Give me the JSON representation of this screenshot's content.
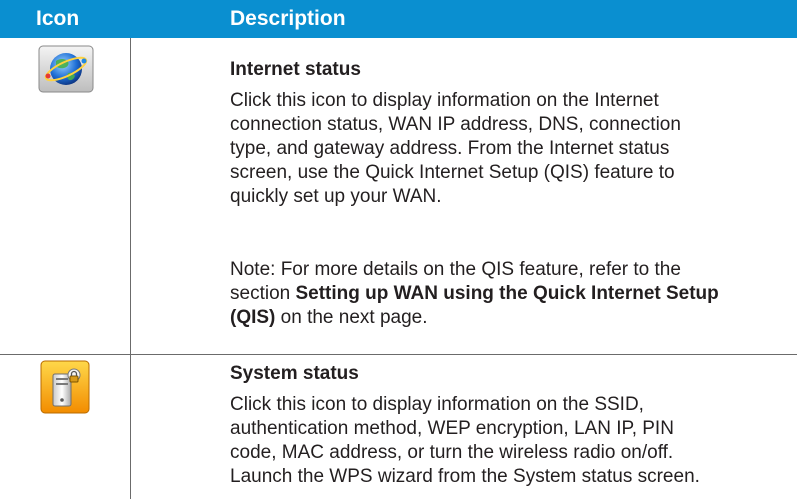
{
  "header": {
    "icon_col": "Icon",
    "desc_col": "Description"
  },
  "rows": [
    {
      "icon": "internet-status-globe-icon",
      "title": "Internet status",
      "para1_lines": [
        "Click this icon to display information on the Internet",
        "connection status, WAN IP address,  DNS, connection",
        "type, and gateway address.  From the Internet status",
        "screen, use the Quick Internet Setup (QIS) feature to",
        "quickly set up your WAN."
      ],
      "note_line1": "Note: For more details on the QIS feature, refer to the",
      "note_line2_prefix": "section ",
      "note_line2_bold": "Setting up WAN using the Quick Internet Setup",
      "note_line3_bold": "(QIS)",
      "note_line3_suffix": " on the next page."
    },
    {
      "icon": "system-status-computer-lock-icon",
      "title": "System status",
      "para1_lines": [
        "Click this icon to display information on the SSID,",
        "authentication method, WEP encryption, LAN IP, PIN",
        "code, MAC address, or turn the wireless radio on/off.",
        "Launch the WPS wizard from the System status screen."
      ]
    }
  ],
  "colors": {
    "header_bg": "#0a8fd0",
    "header_text": "#ffffff",
    "body_text": "#231f20",
    "rule": "#6b6b6b"
  }
}
